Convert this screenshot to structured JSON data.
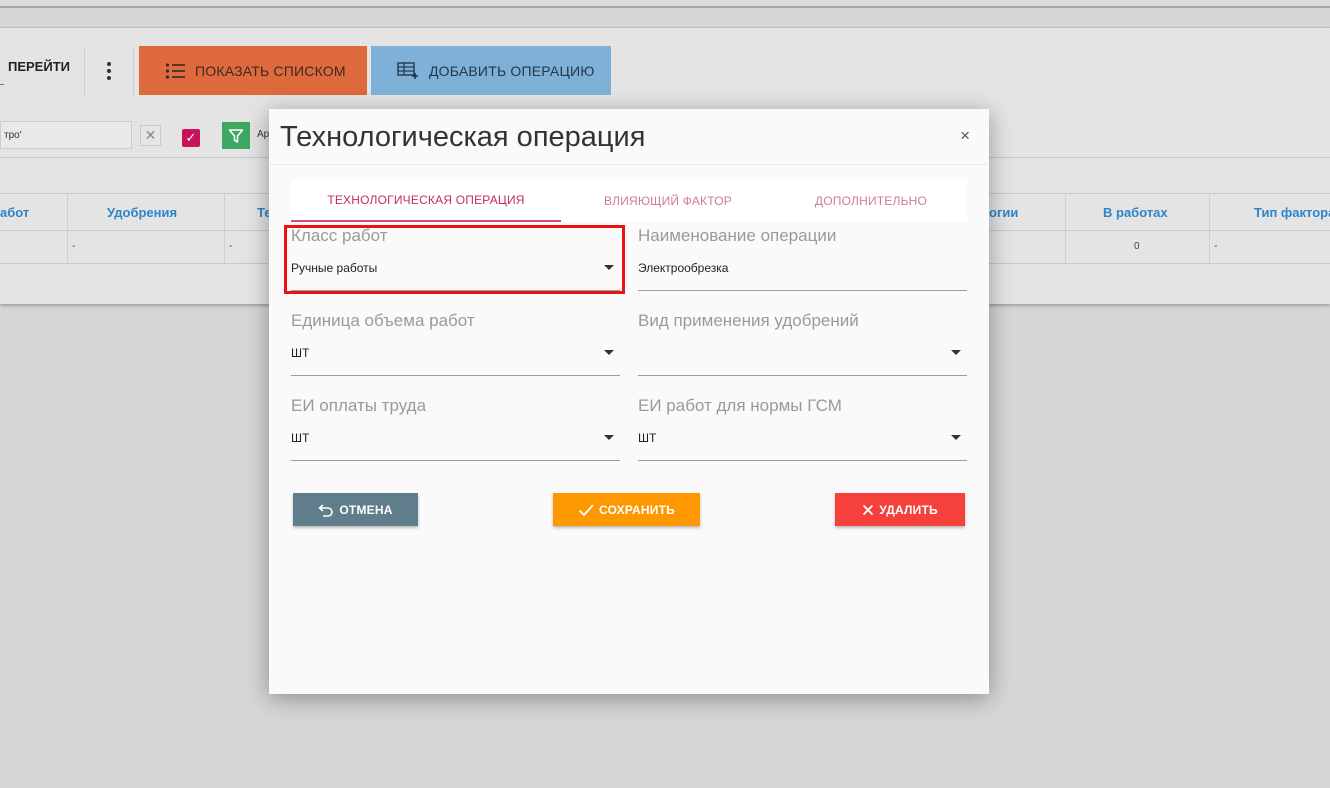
{
  "toolbar": {
    "goto_label": "ПЕРЕЙТИ",
    "show_list_label": "ПОКАЗАТЬ СПИСКОМ",
    "add_operation_label": "ДОБАВИТЬ ОПЕРАЦИЮ"
  },
  "filter": {
    "input_value": "тро'",
    "clear_glyph": "✕",
    "check_glyph": "✓",
    "label_partial": "Ар"
  },
  "table": {
    "headers": [
      "абот",
      "Удобрения",
      "Те",
      "огии",
      "В работах",
      "Тип фактора"
    ],
    "row": [
      "-",
      "-",
      "0",
      "-"
    ]
  },
  "modal": {
    "title": "Технологическая операция",
    "close_glyph": "×",
    "tabs": [
      "ТЕХНОЛОГИЧЕСКАЯ ОПЕРАЦИЯ",
      "ВЛИЯЮЩИЙ ФАКТОР",
      "ДОПОЛНИТЕЛЬНО"
    ],
    "fields": {
      "work_class": {
        "label": "Класс работ",
        "value": "Ручные работы"
      },
      "operation_name": {
        "label": "Наименование операции",
        "value": "Электрообрезка"
      },
      "work_unit": {
        "label": "Единица объема работ",
        "value": "ШТ"
      },
      "fertilizer_type": {
        "label": "Вид применения удобрений",
        "value": ""
      },
      "labor_unit": {
        "label": "ЕИ оплаты труда",
        "value": "ШТ"
      },
      "fuel_unit": {
        "label": "ЕИ работ для нормы ГСМ",
        "value": "ШТ"
      }
    },
    "buttons": {
      "cancel": "ОТМЕНА",
      "save": "СОХРАНИТЬ",
      "delete": "УДАЛИТЬ"
    }
  },
  "colors": {
    "accent_tab": "#c52a64",
    "highlight": "#ee1111",
    "save": "#fd9800",
    "delete": "#f5403c",
    "cancel": "#5f7d8b",
    "show_list": "#de6a3e",
    "add_operation": "#7fb1d8",
    "table_header": "#2d86c8"
  }
}
